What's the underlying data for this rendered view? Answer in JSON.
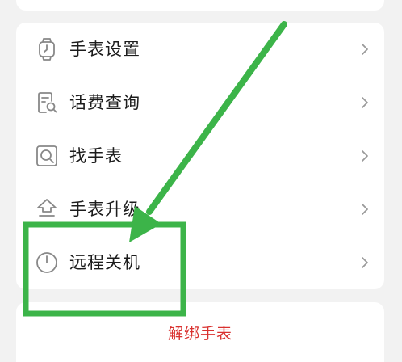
{
  "menu": {
    "items": [
      {
        "label": "手表设置",
        "icon": "watch-icon"
      },
      {
        "label": "话费查询",
        "icon": "bill-search-icon"
      },
      {
        "label": "找手表",
        "icon": "find-watch-icon"
      },
      {
        "label": "手表升级",
        "icon": "upgrade-icon"
      },
      {
        "label": "远程关机",
        "icon": "power-icon"
      }
    ]
  },
  "unbind": {
    "label": "解绑手表"
  },
  "colors": {
    "unbind_text": "#d9312f",
    "annotation_green": "#3cb449",
    "icon_gray": "#888888",
    "background": "#f2f2f2"
  }
}
